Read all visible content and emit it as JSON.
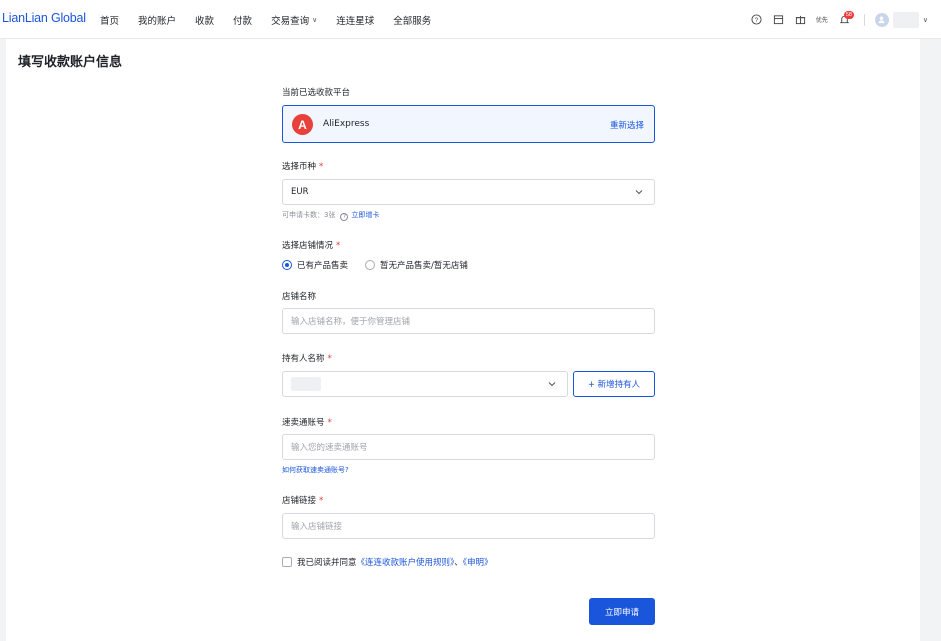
{
  "brand": {
    "logo_text": "LianLian Global",
    "accent": "#1a56db"
  },
  "nav": {
    "items": [
      "首页",
      "我的账户",
      "收款",
      "付款",
      "交易查询",
      "连连星球",
      "全部服务"
    ],
    "dropdown_item_index": 4
  },
  "header_tools": {
    "icons": [
      "help-icon",
      "calendar-icon",
      "gift-icon"
    ],
    "language_text": "优先",
    "notification_count": "58"
  },
  "page": {
    "title": "填写收款账户信息"
  },
  "form": {
    "platform": {
      "label": "当前已选收款平台",
      "logo_letter": "A",
      "name": "AliExpress",
      "reselect": "重新选择"
    },
    "currency": {
      "label": "选择币种",
      "required_mark": "*",
      "value": "EUR",
      "hint_prefix": "可申请卡数：3张",
      "hint_info": "?",
      "hint_link": "立即增卡"
    },
    "store_status": {
      "label": "选择店铺情况",
      "required_mark": "*",
      "options": [
        "已有产品售卖",
        "暂无产品售卖/暂无店铺"
      ],
      "selected_index": 0
    },
    "store_name": {
      "label": "店铺名称",
      "placeholder": "输入店铺名称，便于你管理店铺"
    },
    "holder": {
      "label": "持有人名称",
      "required_mark": "*",
      "add_button": "+ 新增持有人"
    },
    "account_no": {
      "label": "速卖通账号",
      "required_mark": "*",
      "placeholder": "输入您的速卖通账号",
      "help_link": "如何获取速卖通账号?"
    },
    "store_link": {
      "label": "店铺链接",
      "required_mark": "*",
      "placeholder": "输入店铺链接"
    },
    "agreement": {
      "prefix": "我已阅读并同意",
      "link1": "《连连收款账户使用规则》",
      "separator": "、",
      "link2": "《申明》"
    },
    "submit": "立即申请"
  }
}
